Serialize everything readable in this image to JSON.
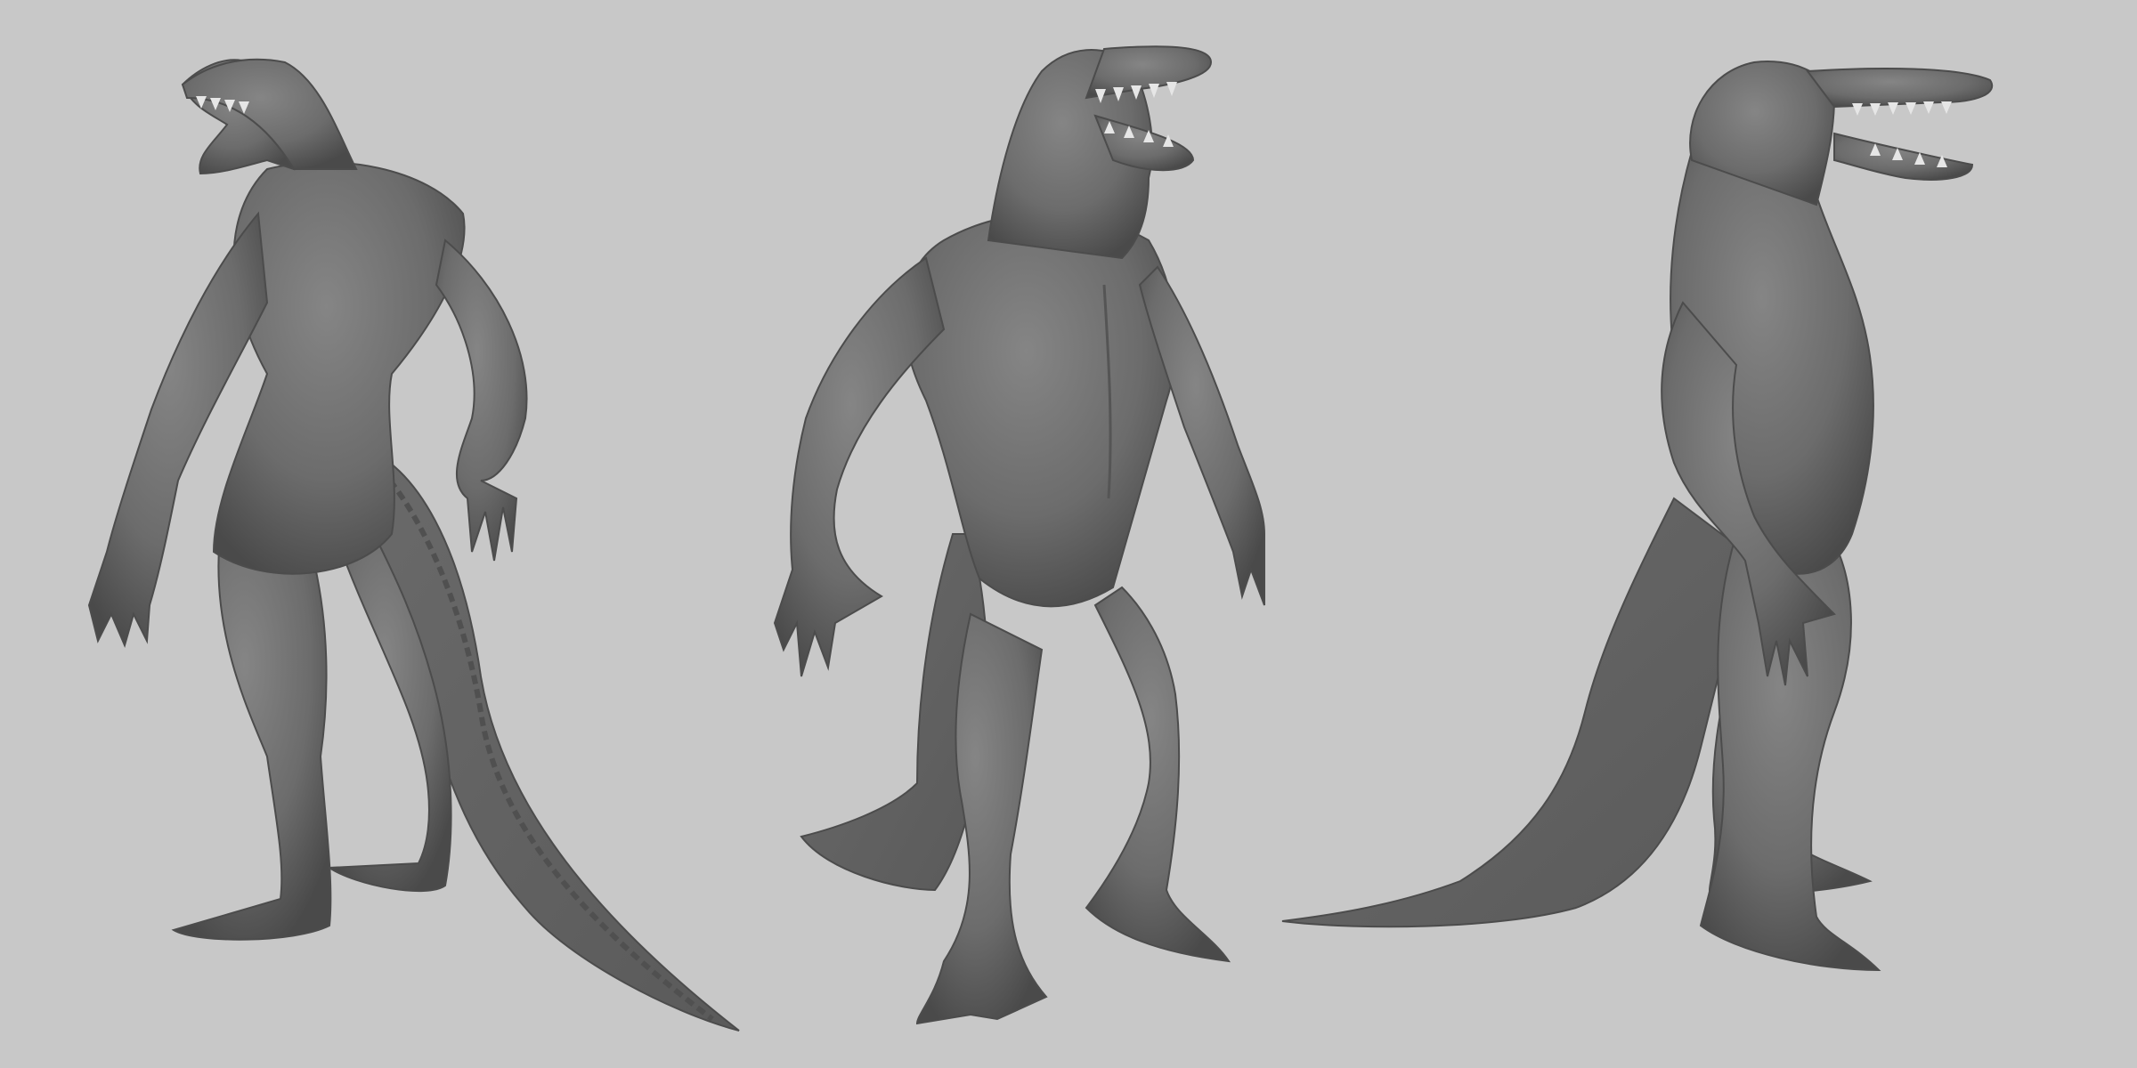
{
  "viewport": {
    "background_color": "#c8c8c8",
    "model_color": "#6e6e6e",
    "model_shadow_color": "#3c3c3c",
    "model_highlight_color": "#8a8a8a",
    "teeth_color": "#e6e6e6"
  },
  "views": [
    {
      "name": "back-three-quarter-view",
      "model": "crocodile-humanoid-sculpt"
    },
    {
      "name": "front-three-quarter-view",
      "model": "crocodile-humanoid-sculpt"
    },
    {
      "name": "side-view",
      "model": "crocodile-humanoid-sculpt"
    }
  ]
}
